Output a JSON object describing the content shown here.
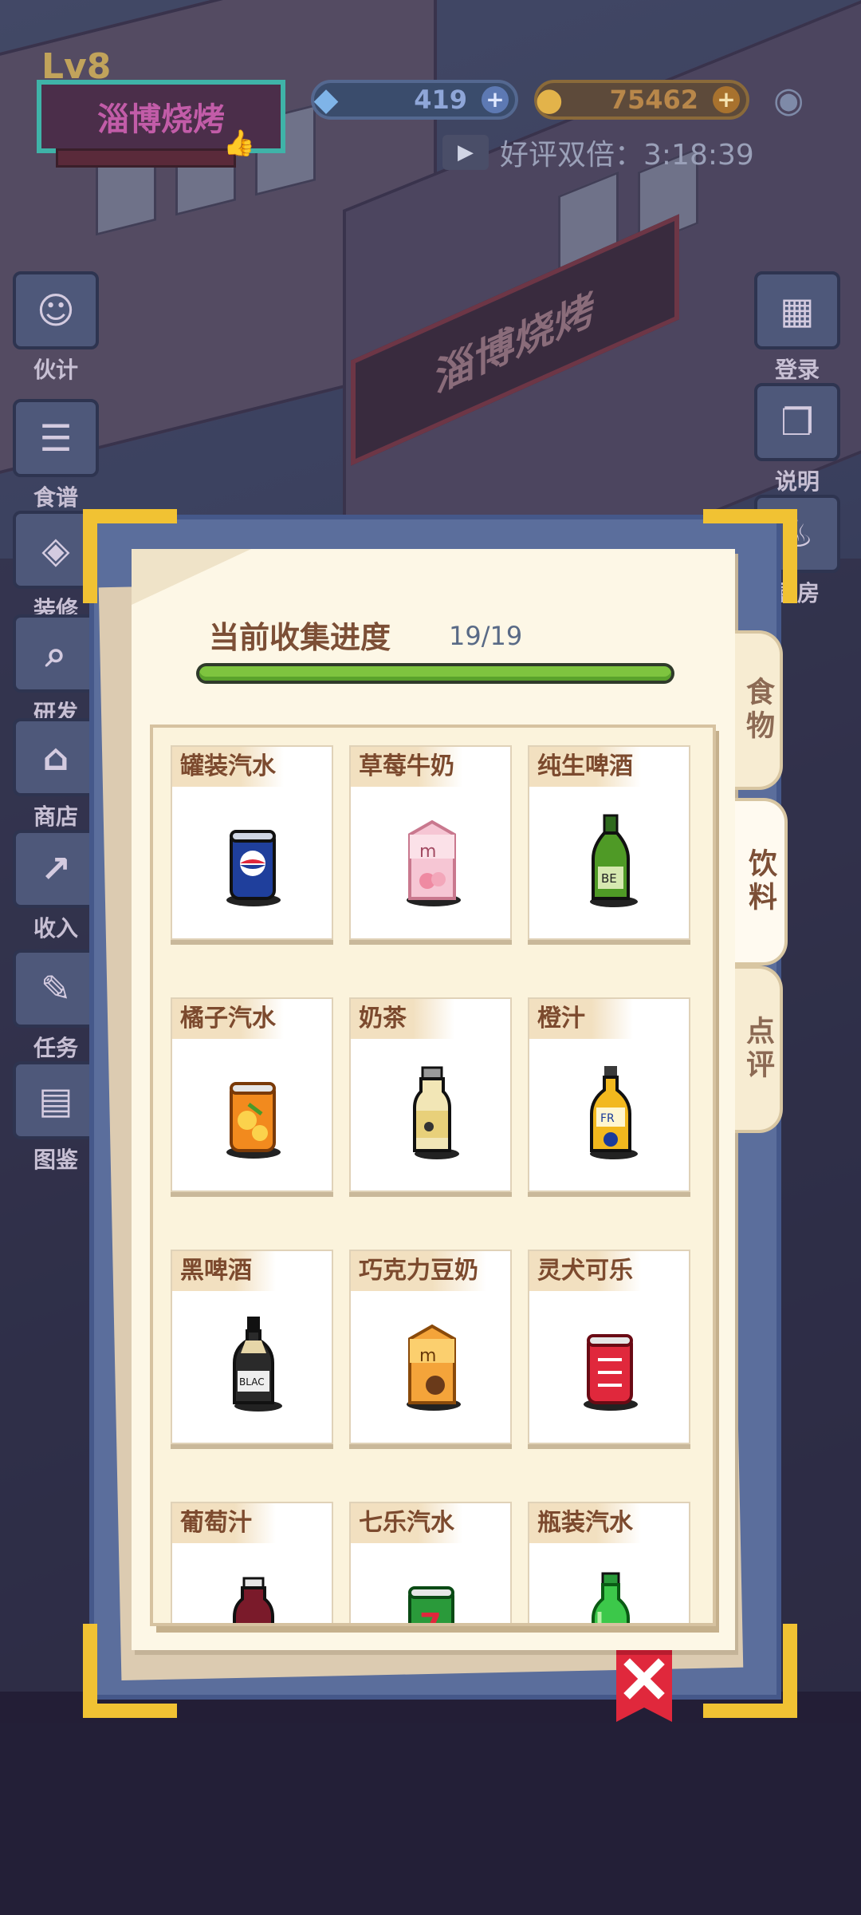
{
  "hud": {
    "level": "Lv8",
    "shop_name": "淄博烧烤",
    "gems": "419",
    "coins": "75462",
    "ad_text": "好评双倍：3:18:39",
    "scene_sign": "淄博烧烤",
    "side_left": [
      "伙计",
      "食谱",
      "装修",
      "研发",
      "商店",
      "收入",
      "任务",
      "图鉴"
    ],
    "side_right": [
      "登录",
      "说明",
      "厨房"
    ]
  },
  "collection": {
    "progress_label": "当前收集进度",
    "progress_count": "19/19",
    "progress_fraction": 1.0,
    "tabs": [
      {
        "label": "食物",
        "active": false
      },
      {
        "label": "饮料",
        "active": true
      },
      {
        "label": "点评",
        "active": false
      }
    ],
    "items": [
      {
        "name": "罐装汽水",
        "icon": "blue-soda-can-icon"
      },
      {
        "name": "草莓牛奶",
        "icon": "strawberry-milk-carton-icon"
      },
      {
        "name": "纯生啤酒",
        "icon": "green-beer-bottle-icon"
      },
      {
        "name": "橘子汽水",
        "icon": "orange-soda-can-icon"
      },
      {
        "name": "奶茶",
        "icon": "milk-tea-bottle-icon"
      },
      {
        "name": "橙汁",
        "icon": "orange-juice-bottle-icon"
      },
      {
        "name": "黑啤酒",
        "icon": "black-beer-bottle-icon"
      },
      {
        "name": "巧克力豆奶",
        "icon": "chocolate-soy-milk-carton-icon"
      },
      {
        "name": "灵犬可乐",
        "icon": "red-cola-can-icon"
      },
      {
        "name": "葡萄汁",
        "icon": "grape-juice-bottle-icon"
      },
      {
        "name": "七乐汽水",
        "icon": "green-soda-can-icon"
      },
      {
        "name": "瓶装汽水",
        "icon": "green-soda-bottle-icon"
      }
    ],
    "close_icon": "close-icon"
  },
  "colors": {
    "frame": "#5b6e9c",
    "corner": "#f1c233",
    "progress": "#7ec43f",
    "close": "#e0283c"
  }
}
